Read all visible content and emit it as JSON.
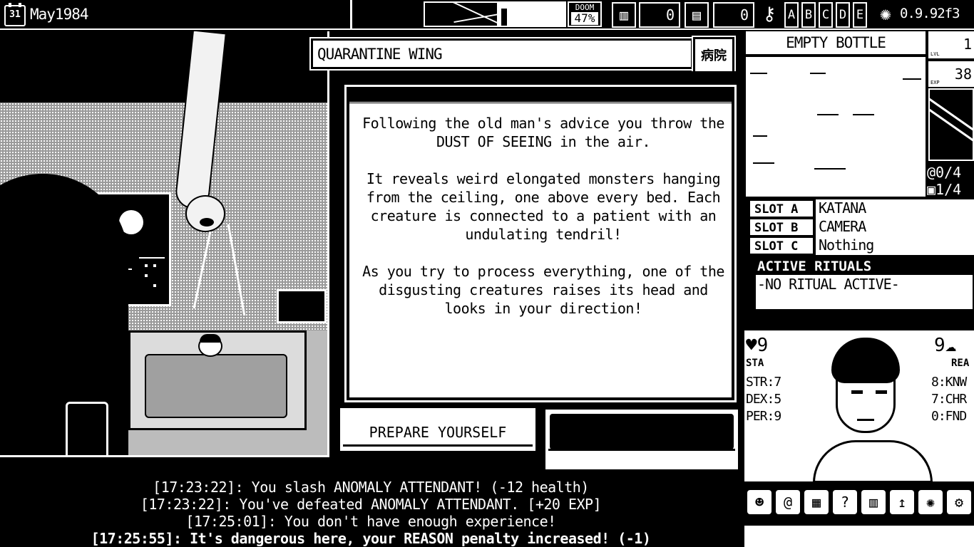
{
  "topbar": {
    "calendar_day": "31",
    "date": "May1984",
    "doom_label": "DOOM",
    "doom_percent": "47%",
    "counter1": "0",
    "counter2": "0",
    "letters": [
      "A",
      "B",
      "C",
      "D",
      "E"
    ],
    "version": "0.9.92f3"
  },
  "event": {
    "location": "QUARANTINE WING",
    "location_icon": "病院",
    "paragraphs": [
      "Following the old man's advice you throw the DUST OF SEEING in the air.",
      "It reveals weird elongated monsters hanging from the ceiling, one above every bed. Each creature is connected to a patient with an undulating tendril!",
      "As you try to process everything, one of the disgusting creatures raises its head and looks in your direction!"
    ],
    "choices": [
      "PREPARE YOURSELF",
      ""
    ]
  },
  "log": [
    {
      "text": "[17:23:22]: You slash ANOMALY ATTENDANT! (-12 health)",
      "bold": false
    },
    {
      "text": "[17:23:22]: You've defeated ANOMALY ATTENDANT. [+20 EXP]",
      "bold": false
    },
    {
      "text": "[17:25:01]: You don't have enough experience!",
      "bold": false
    },
    {
      "text": "[17:25:55]: It's dangerous here, your REASON penalty increased! (-1)",
      "bold": true
    }
  ],
  "inventory": {
    "item_name": "EMPTY BOTTLE",
    "level_label": "LVL",
    "level": "1",
    "exp_label": "EXP",
    "exp": "38",
    "spells": "0/4",
    "cases": "1/4"
  },
  "slots": [
    {
      "label": "SLOT A",
      "value": "KATANA"
    },
    {
      "label": "SLOT B",
      "value": "CAMERA"
    },
    {
      "label": "SLOT C",
      "value": "Nothing"
    }
  ],
  "rituals": {
    "header": "ACTIVE RITUALS",
    "text": "-NO RITUAL ACTIVE-"
  },
  "character": {
    "sta_value": "9",
    "sta_label": "STA",
    "rea_value": "9",
    "rea_label": "REA",
    "left_stats": [
      "STR:7",
      "DEX:5",
      "PER:9"
    ],
    "right_stats": [
      "8:KNW",
      "7:CHR",
      "0:FND"
    ]
  }
}
